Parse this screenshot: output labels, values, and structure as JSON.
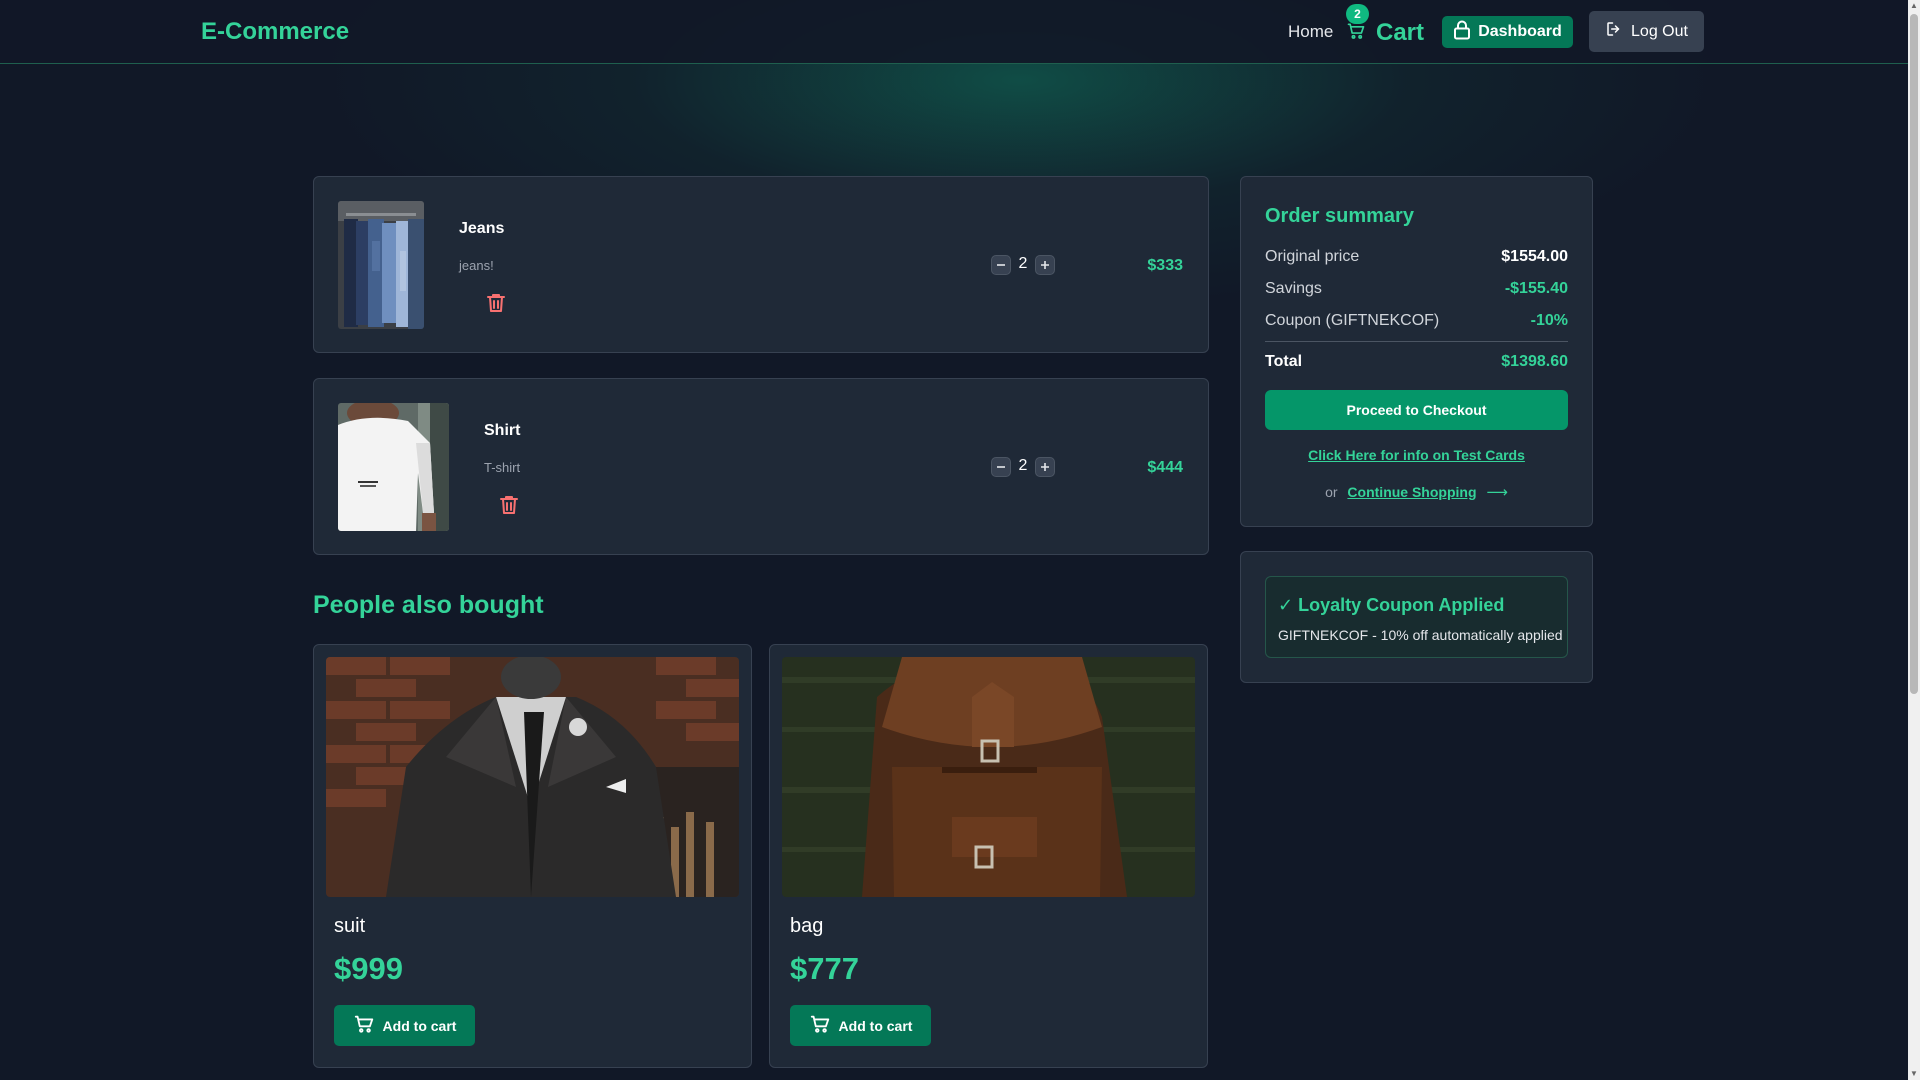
{
  "nav": {
    "brand": "E-Commerce",
    "home": "Home",
    "cart_count": "2",
    "cart_label": "Cart",
    "dashboard": "Dashboard",
    "logout": "Log Out"
  },
  "cart_items": [
    {
      "name": "Jeans",
      "description": "jeans!",
      "quantity": "2",
      "price": "$333"
    },
    {
      "name": "Shirt",
      "description": "T-shirt",
      "quantity": "2",
      "price": "$444"
    }
  ],
  "summary": {
    "title": "Order summary",
    "original_label": "Original price",
    "original_value": "$1554.00",
    "savings_label": "Savings",
    "savings_value": "-$155.40",
    "coupon_label": "Coupon (GIFTNEKCOF)",
    "coupon_value": "-10%",
    "total_label": "Total",
    "total_value": "$1398.60",
    "checkout": "Proceed to Checkout",
    "test_cards": "Click Here for info on Test Cards",
    "or": "or",
    "continue": "Continue Shopping",
    "arrow": "⟶"
  },
  "loyalty": {
    "title": "✓ Loyalty Coupon Applied",
    "text": "GIFTNEKCOF - 10% off automatically applied"
  },
  "recommendations": {
    "title": "People also bought",
    "items": [
      {
        "name": "suit",
        "price": "$999",
        "button": "Add to cart"
      },
      {
        "name": "bag",
        "price": "$777",
        "button": "Add to cart"
      }
    ]
  },
  "colors": {
    "accent": "#34d399",
    "button": "#047857",
    "background": "#111827",
    "card": "#1f2937",
    "danger": "#f87171"
  }
}
